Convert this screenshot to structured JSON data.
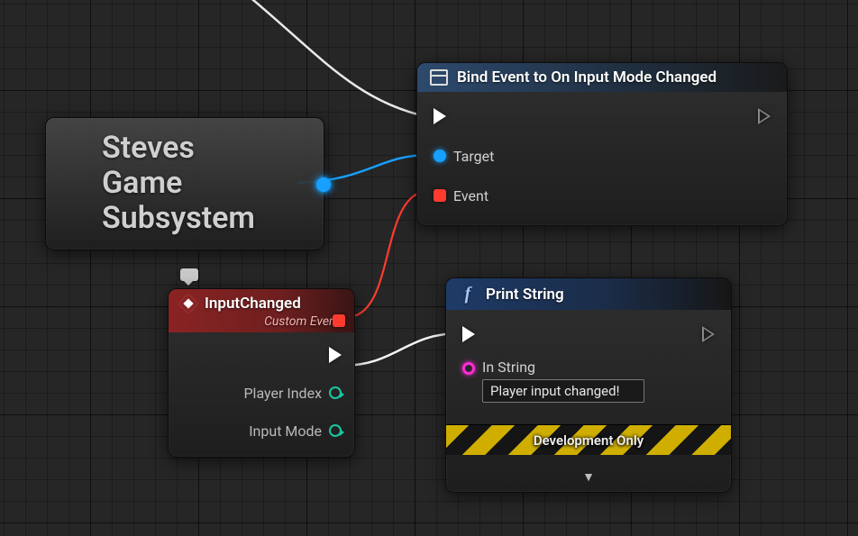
{
  "subsystem": {
    "title_line1": "Steves",
    "title_line2": "Game",
    "title_line3": "Subsystem"
  },
  "bind_node": {
    "title": "Bind Event to On Input Mode Changed",
    "pins": {
      "target": "Target",
      "event": "Event"
    }
  },
  "event_node": {
    "title": "InputChanged",
    "subtitle": "Custom Event",
    "outputs": {
      "player_index": "Player Index",
      "input_mode": "Input Mode"
    }
  },
  "print_node": {
    "title": "Print String",
    "in_string_label": "In String",
    "in_string_value": "Player input changed!",
    "dev_banner": "Development Only",
    "expand_caret": "▼"
  }
}
